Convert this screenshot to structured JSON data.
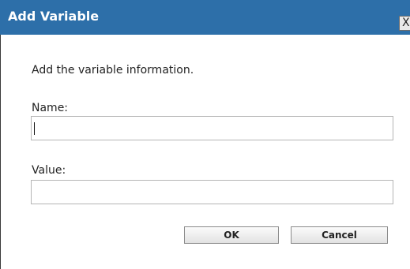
{
  "dialog": {
    "title": "Add Variable",
    "close_label": "X",
    "instruction": "Add the variable information.",
    "fields": {
      "name": {
        "label": "Name:",
        "value": "",
        "placeholder": ""
      },
      "value": {
        "label": "Value:",
        "value": "",
        "placeholder": ""
      }
    },
    "buttons": {
      "ok": "OK",
      "cancel": "Cancel"
    }
  },
  "colors": {
    "titlebar": "#2d6fa9",
    "title_text": "#ffffff",
    "border": "#b5b5b5"
  }
}
